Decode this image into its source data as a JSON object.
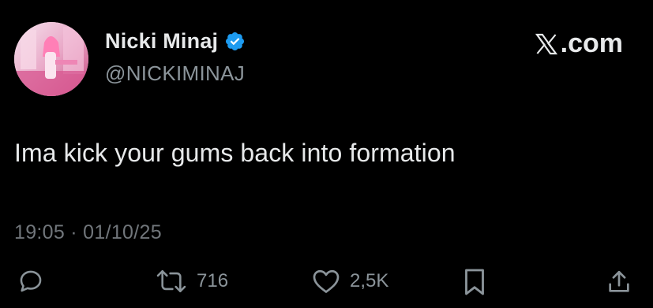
{
  "author": {
    "name": "Nicki Minaj",
    "handle": "@NICKIMINAJ",
    "verified": true
  },
  "brand": {
    "label": ".com",
    "icon": "x-logo-icon"
  },
  "tweet": {
    "text": "Ima kick your gums back into formation",
    "timestamp": "19:05 · 01/10/25"
  },
  "actions": {
    "reply": {
      "icon": "reply-icon",
      "count": ""
    },
    "retweet": {
      "icon": "retweet-icon",
      "count": "716"
    },
    "like": {
      "icon": "heart-icon",
      "count": "2,5K"
    },
    "bookmark": {
      "icon": "bookmark-icon"
    },
    "share": {
      "icon": "share-icon"
    }
  },
  "colors": {
    "background": "#000000",
    "text_primary": "#e7e9ea",
    "text_secondary": "#8b949a",
    "verified_blue": "#1d9bf0"
  }
}
